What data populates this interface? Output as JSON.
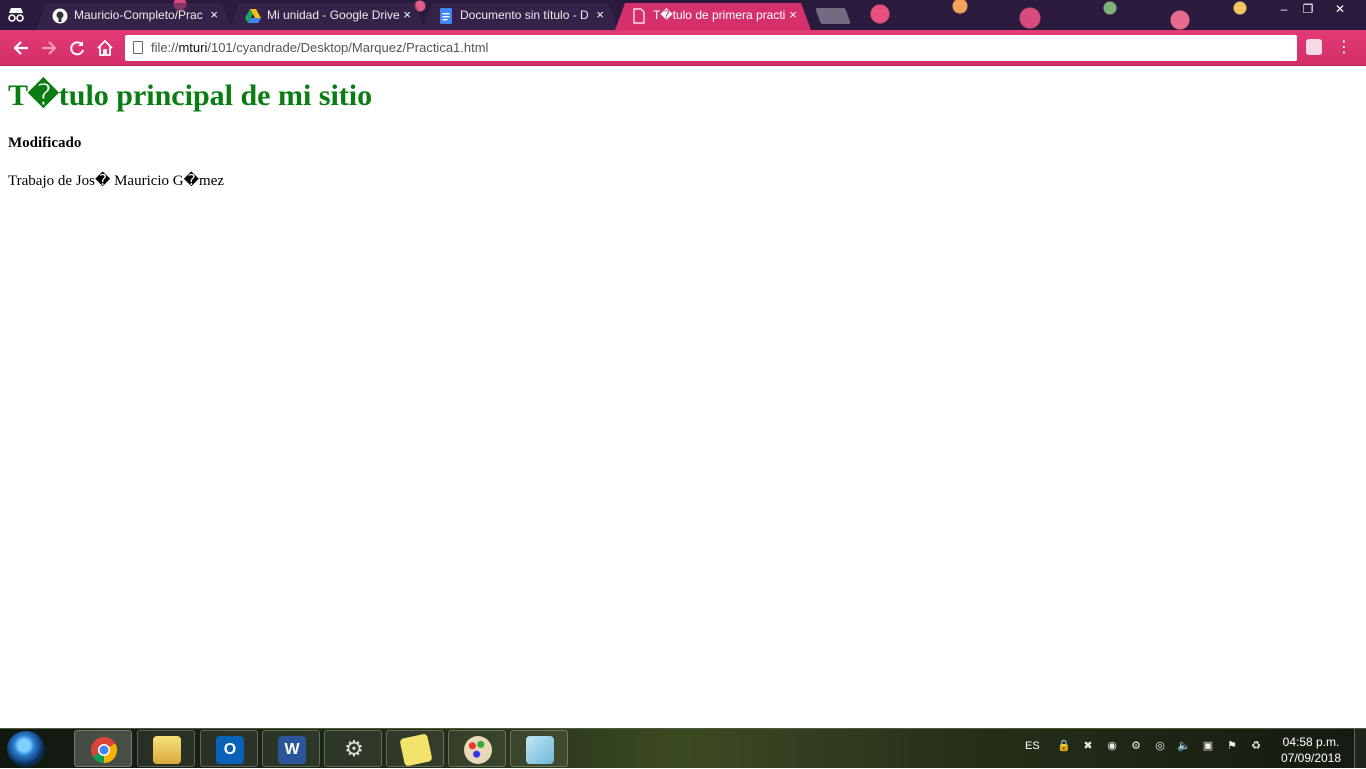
{
  "browser": {
    "tabs": [
      {
        "title": "Mauricio-Completo/Prac",
        "icon": "github-icon",
        "close": "×"
      },
      {
        "title": "Mi unidad - Google Drive",
        "icon": "google-drive-icon",
        "close": "×"
      },
      {
        "title": "Documento sin título - D",
        "icon": "google-docs-icon",
        "close": "×"
      },
      {
        "title": "T�tulo de primera practi",
        "icon": "page-icon",
        "close": "×"
      }
    ],
    "address": {
      "prefix": "file://",
      "host": "mturi",
      "path": "/101/cyandrade/Desktop/Marquez/Practica1.html"
    },
    "window_controls": {
      "minimize": "–",
      "restore": "❐",
      "close": "✕"
    },
    "theme_color": "#d6306b"
  },
  "page": {
    "title": "T�tulo principal de mi sitio",
    "subtitle": "Modificado",
    "text": "Trabajo de Jos� Mauricio G�mez",
    "title_color": "#0a7d12"
  },
  "taskbar": {
    "apps": [
      {
        "name": "chrome-icon",
        "active": true
      },
      {
        "name": "file-explorer-icon",
        "active": false
      },
      {
        "name": "outlook-icon",
        "active": false
      },
      {
        "name": "word-icon",
        "active": false
      },
      {
        "name": "settings-icon",
        "active": false
      },
      {
        "name": "sticky-notes-icon",
        "active": false
      },
      {
        "name": "paint-icon",
        "active": false
      },
      {
        "name": "snipping-tool-icon",
        "active": false
      }
    ],
    "language": "ES",
    "time": "04:58 p.m.",
    "date": "07/09/2018"
  }
}
